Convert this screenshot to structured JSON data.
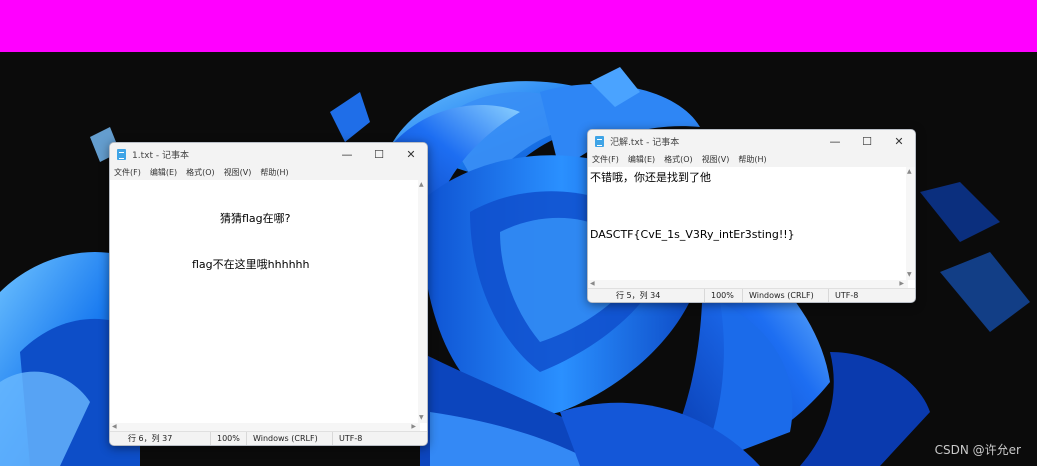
{
  "window1": {
    "title": "1.txt - 记事本",
    "menu": [
      "文件(F)",
      "编辑(E)",
      "格式(O)",
      "视图(V)",
      "帮助(H)"
    ],
    "lines": [
      "猜猜flag在哪?",
      "flag不在这里哦hhhhhh"
    ],
    "status": {
      "position": "行 6，列 37",
      "zoom": "100%",
      "line_ending": "Windows (CRLF)",
      "encoding": "UTF-8"
    }
  },
  "window2": {
    "title": "汜解.txt - 记事本",
    "menu": [
      "文件(F)",
      "编辑(E)",
      "格式(O)",
      "视图(V)",
      "帮助(H)"
    ],
    "lines": [
      "不错哦，你还是找到了他",
      "DASCTF{CvE_1s_V3Ry_intEr3sting!!}"
    ],
    "status": {
      "position": "行 5，列 34",
      "zoom": "100%",
      "line_ending": "Windows (CRLF)",
      "encoding": "UTF-8"
    }
  },
  "window_controls": {
    "minimize": "—",
    "maximize": "☐",
    "close": "✕"
  },
  "watermark": "CSDN @许允er",
  "colors": {
    "top_bar": "#ff00ff",
    "desktop_background": "#0b0b0b",
    "wallpaper_blue": "#1473e6"
  },
  "icons": {
    "app_icon": "notepad-icon",
    "minimize": "minimize-icon",
    "maximize": "maximize-icon",
    "close": "close-icon"
  }
}
